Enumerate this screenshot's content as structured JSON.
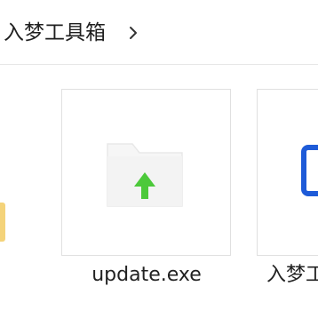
{
  "breadcrumb": {
    "folder_label": "入梦工具箱"
  },
  "files": [
    {
      "name": "update.exe"
    },
    {
      "name": "入梦工"
    }
  ],
  "colors": {
    "arrow": "#4cc93a",
    "accent_blue": "#1e5bd8",
    "folder_yellow": "#f4d37a"
  }
}
